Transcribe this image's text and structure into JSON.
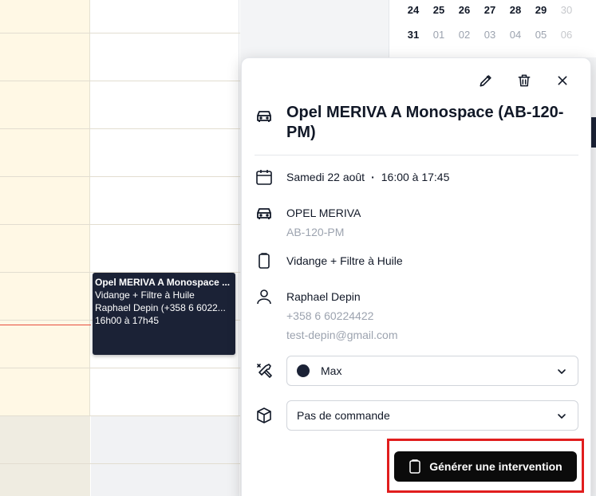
{
  "mini_calendar": {
    "rows": [
      [
        "24",
        "25",
        "26",
        "27",
        "28",
        "29",
        "30"
      ],
      [
        "31",
        "01",
        "02",
        "03",
        "04",
        "05",
        "06"
      ]
    ]
  },
  "event": {
    "title": "Opel MERIVA A Monospace ...",
    "service": "Vidange + Filtre à Huile",
    "customer": "Raphael Depin (+358 6 6022...",
    "time": "16h00 à 17h45"
  },
  "help": {
    "label": "?"
  },
  "popover": {
    "icons": {
      "edit": "pencil-icon",
      "delete": "trash-icon",
      "close": "close-icon"
    },
    "title": "Opel MERIVA A Monospace (AB-120-PM)",
    "date": "Samedi 22 août",
    "time_range": "16:00 à 17:45",
    "vehicle": {
      "model": "OPEL MERIVA",
      "plate": "AB-120-PM"
    },
    "service": "Vidange + Filtre à Huile",
    "customer": {
      "name": "Raphael Depin",
      "phone": "+358 6 60224422",
      "email": "test-depin@gmail.com"
    },
    "mechanic_select": {
      "value": "Max",
      "color": "#1b2236"
    },
    "order_select": {
      "value": "Pas de commande"
    },
    "generate_button": {
      "label": "Générer une intervention"
    }
  },
  "colors": {
    "event_bg": "#1b2236",
    "highlight": "#e11d1d",
    "primary_button": "#0b0b0b"
  }
}
